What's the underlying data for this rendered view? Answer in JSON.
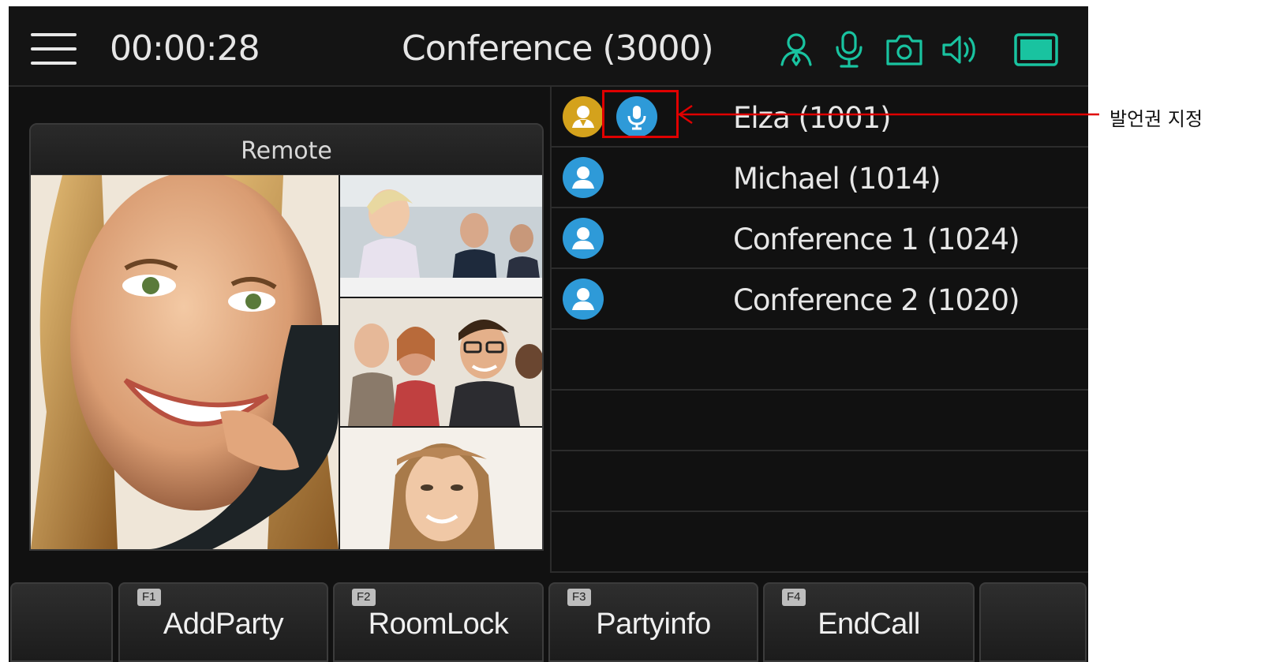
{
  "topbar": {
    "timer": "00:00:28",
    "title": "Conference (3000)",
    "icons": [
      "attendees-icon",
      "microphone-icon",
      "camera-icon",
      "speaker-icon",
      "screen-icon"
    ],
    "accent_color": "#19c3a0"
  },
  "remote": {
    "label": "Remote"
  },
  "participants": [
    {
      "name": "Elza (1001)",
      "avatar_color": "#d4a21c",
      "role": "host",
      "has_floor": true
    },
    {
      "name": "Michael (1014)",
      "avatar_color": "#2e9ad8",
      "role": "member",
      "has_floor": false
    },
    {
      "name": "Conference 1 (1024)",
      "avatar_color": "#2e9ad8",
      "role": "member",
      "has_floor": false
    },
    {
      "name": "Conference 2 (1020)",
      "avatar_color": "#2e9ad8",
      "role": "member",
      "has_floor": false
    }
  ],
  "softkeys": [
    {
      "fn": "",
      "label": ""
    },
    {
      "fn": "F1",
      "label": "AddParty"
    },
    {
      "fn": "F2",
      "label": "RoomLock"
    },
    {
      "fn": "F3",
      "label": "Partyinfo"
    },
    {
      "fn": "F4",
      "label": "EndCall"
    },
    {
      "fn": "",
      "label": ""
    }
  ],
  "annotation": {
    "text": "발언권 지정",
    "color": "#e00000"
  }
}
